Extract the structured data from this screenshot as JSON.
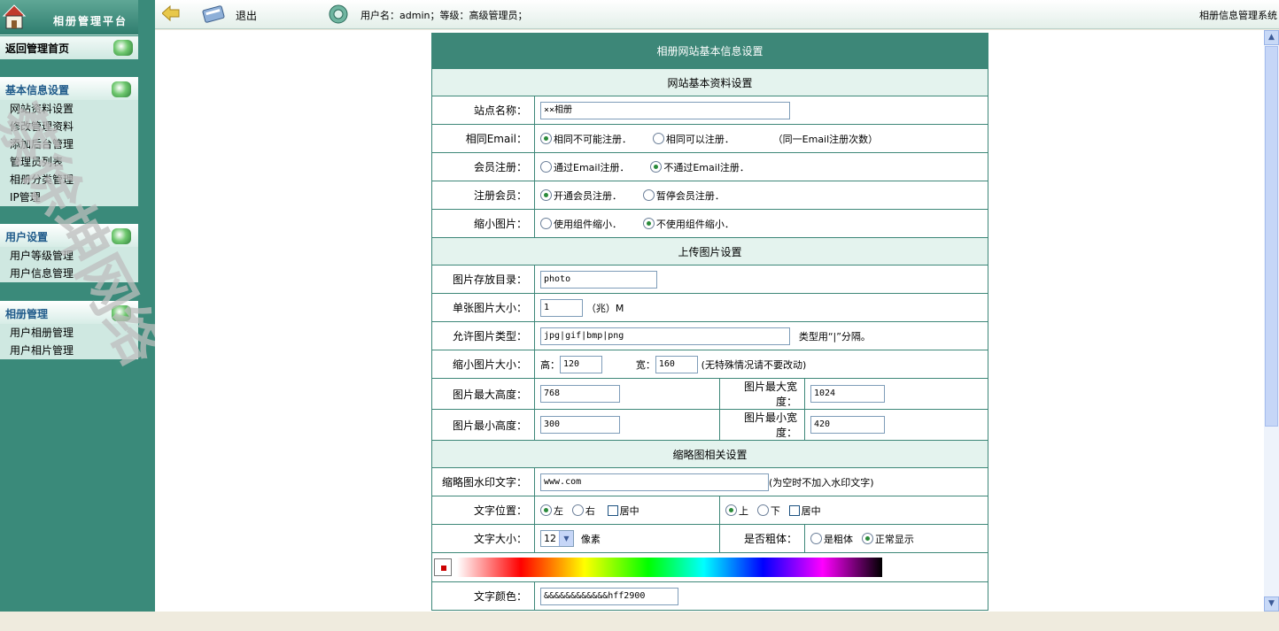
{
  "sidebar": {
    "brand_title": "相册管理平台",
    "home_label": "返回管理首页",
    "sections": [
      {
        "title": "基本信息设置",
        "items": [
          "网站资料设置",
          "修改管理资料",
          "添加后台管理",
          "管理员列表",
          "相册分类管理",
          "IP管理"
        ]
      },
      {
        "title": "用户设置",
        "items": [
          "用户等级管理",
          "用户信息管理"
        ]
      },
      {
        "title": "相册管理",
        "items": [
          "用户相册管理",
          "用户相片管理"
        ]
      }
    ],
    "watermark": "蔡徐坤网络"
  },
  "topbar": {
    "exit_label": "退出",
    "user_info": "用户名：admin；等级：高级管理员；",
    "system_name": "相册信息管理系统"
  },
  "form": {
    "title": "相册网站基本信息设置",
    "section_basic": "网站基本资料设置",
    "site_name_label": "站点名称：",
    "site_name_value": "××相册",
    "same_email_label": "相同Email：",
    "same_email_opt1": "相同不可能注册．",
    "same_email_opt2": "相同可以注册．",
    "same_email_note": "（同一Email注册次数）",
    "member_reg_label": "会员注册：",
    "member_reg_opt1": "通过Email注册．",
    "member_reg_opt2": "不通过Email注册．",
    "reg_member_label": "注册会员：",
    "reg_member_opt1": "开通会员注册．",
    "reg_member_opt2": "暂停会员注册．",
    "thumb_label": "缩小图片：",
    "thumb_opt1": "使用组件缩小．",
    "thumb_opt2": "不使用组件缩小．",
    "section_upload": "上传图片设置",
    "dir_label": "图片存放目录：",
    "dir_value": "photo",
    "size_label": "单张图片大小：",
    "size_value": "1",
    "size_unit": "（兆）M",
    "types_label": "允许图片类型：",
    "types_value": "jpg|gif|bmp|png",
    "types_note": "类型用“|”分隔。",
    "thumb_size_label": "缩小图片大小：",
    "height_label": "高：",
    "height_value": "120",
    "width_label": "宽：",
    "width_value": "160",
    "thumb_size_note": "(无特殊情况请不要改动)",
    "max_height_label": "图片最大高度：",
    "max_height_value": "768",
    "max_width_label": "图片最大宽度：",
    "max_width_value": "1024",
    "min_height_label": "图片最小高度：",
    "min_height_value": "300",
    "min_width_label": "图片最小宽度：",
    "min_width_value": "420",
    "section_thumb": "缩略图相关设置",
    "wm_text_label": "缩略图水印文字：",
    "wm_text_value": "www.com",
    "wm_text_note": "(为空时不加入水印文字)",
    "text_pos_label": "文字位置：",
    "pos_left": "左",
    "pos_right": "右",
    "pos_center": "居中",
    "pos_top": "上",
    "pos_bottom": "下",
    "pos_center2": "居中",
    "font_size_label": "文字大小：",
    "font_size_value": "12",
    "font_size_unit": "像素",
    "bold_label": "是否粗体：",
    "bold_opt1": "是粗体",
    "bold_opt2": "正常显示",
    "color_label": "文字颜色：",
    "color_value": "&&&&&&&&&&&&hff2900"
  },
  "colors": {
    "sidebar": "#3a8a7a",
    "header": "#3d8778",
    "section": "#e4f3ee"
  }
}
